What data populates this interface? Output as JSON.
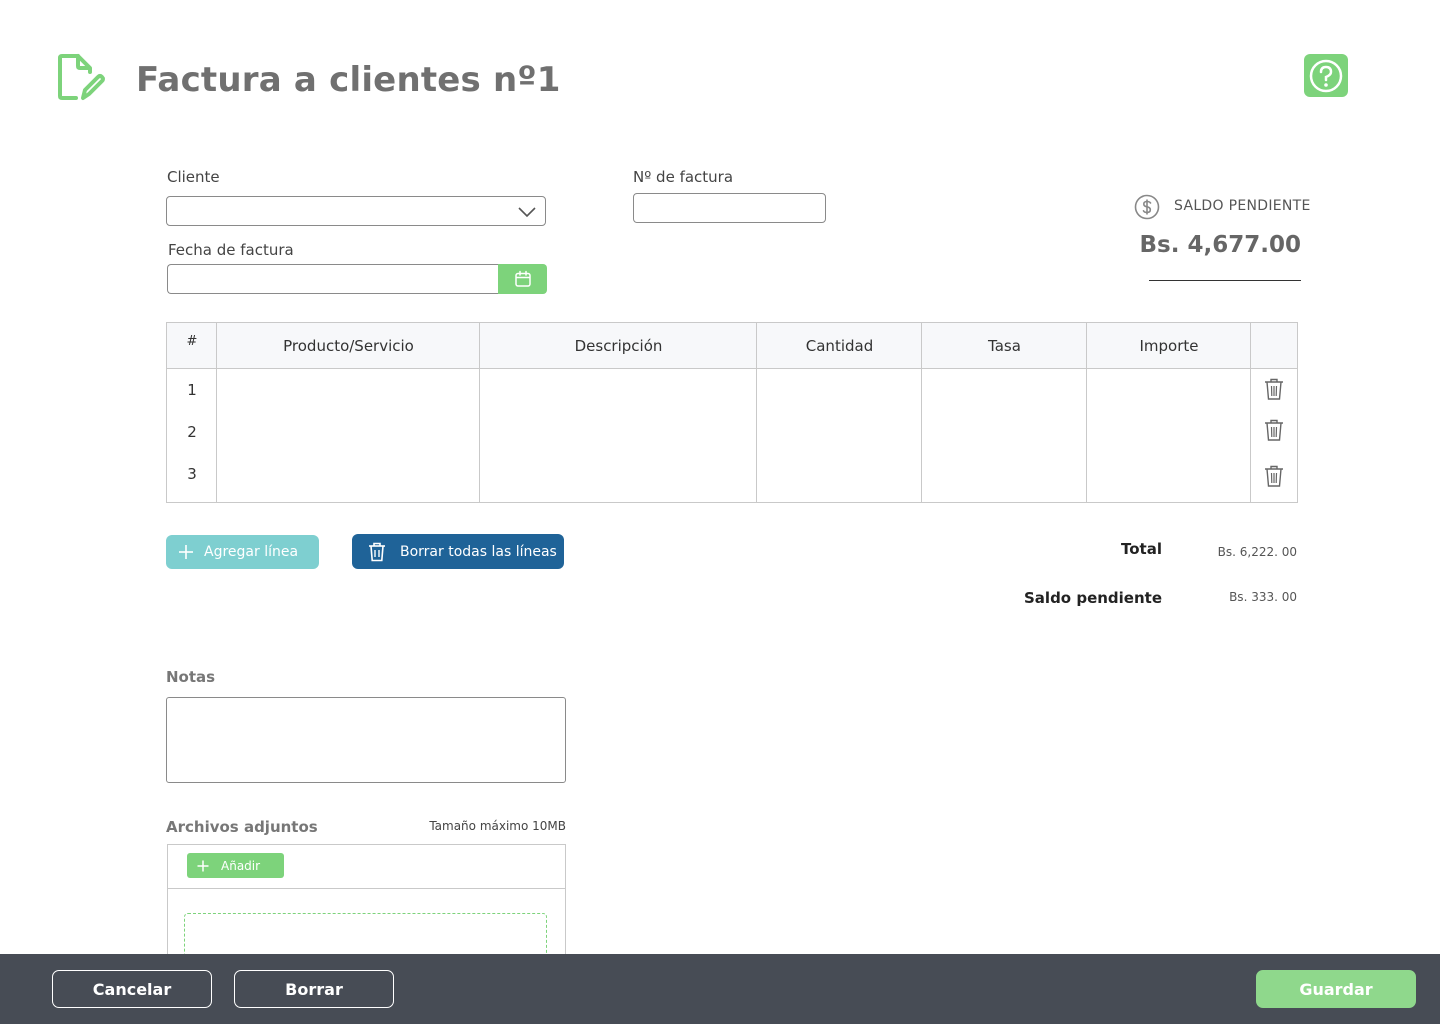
{
  "header": {
    "title": "Factura a clientes nº1",
    "icon": "edit-document-icon",
    "help_icon": "help-icon"
  },
  "form": {
    "cliente_label": "Cliente",
    "cliente_value": "",
    "nfactura_label": "Nº de factura",
    "nfactura_value": "",
    "fecha_label": "Fecha de factura",
    "fecha_value": ""
  },
  "saldo": {
    "label": "SALDO PENDIENTE",
    "amount": "Bs. 4,677.00"
  },
  "table": {
    "headers": [
      "#",
      "Producto/Servicio",
      "Descripción",
      "Cantidad",
      "Tasa",
      "Importe"
    ],
    "rows": [
      {
        "num": "1",
        "producto": "",
        "descripcion": "",
        "cantidad": "",
        "tasa": "",
        "importe": ""
      },
      {
        "num": "2",
        "producto": "",
        "descripcion": "",
        "cantidad": "",
        "tasa": "",
        "importe": ""
      },
      {
        "num": "3",
        "producto": "",
        "descripcion": "",
        "cantidad": "",
        "tasa": "",
        "importe": ""
      }
    ]
  },
  "actions": {
    "add_line": "Agregar línea",
    "clear_lines": "Borrar todas las líneas"
  },
  "totals": {
    "total_label": "Total",
    "total_value": "Bs. 6,222. 00",
    "saldo_label": "Saldo pendiente",
    "saldo_value": "Bs. 333. 00"
  },
  "notes": {
    "label": "Notas",
    "value": ""
  },
  "attachments": {
    "label": "Archivos adjuntos",
    "max_size": "Tamaño máximo 10MB",
    "add_label": "Añadir"
  },
  "footer": {
    "cancel": "Cancelar",
    "delete": "Borrar",
    "save": "Guardar"
  },
  "colors": {
    "accent_green": "#7dd37b",
    "teal": "#7ecfd0",
    "blue": "#1f6398",
    "footer_bg": "#474c55"
  }
}
